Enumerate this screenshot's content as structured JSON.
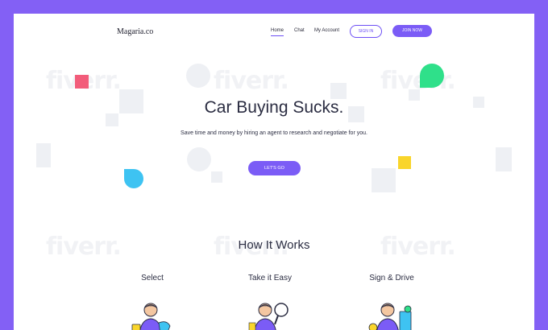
{
  "brand": {
    "logo": "Magaria.co"
  },
  "nav": {
    "links": [
      "Home",
      "Chat",
      "My Account"
    ],
    "signin": "SIGN IN",
    "join": "JOIN NOW"
  },
  "hero": {
    "title": "Car Buying Sucks.",
    "subtitle": "Save time and money by hiring an agent to research and negotiate for you.",
    "cta": "LET'S GO"
  },
  "how": {
    "title": "How It Works",
    "steps": [
      {
        "title": "Select"
      },
      {
        "title": "Take it Easy"
      },
      {
        "title": "Sign & Drive"
      }
    ]
  },
  "watermark": "fiverr.",
  "colors": {
    "frame": "#8360f5",
    "accent": "#7b5cf6",
    "pink": "#f25c7a",
    "green": "#2fe08a",
    "blue": "#3ec3f2",
    "yellow": "#f9d52b"
  }
}
